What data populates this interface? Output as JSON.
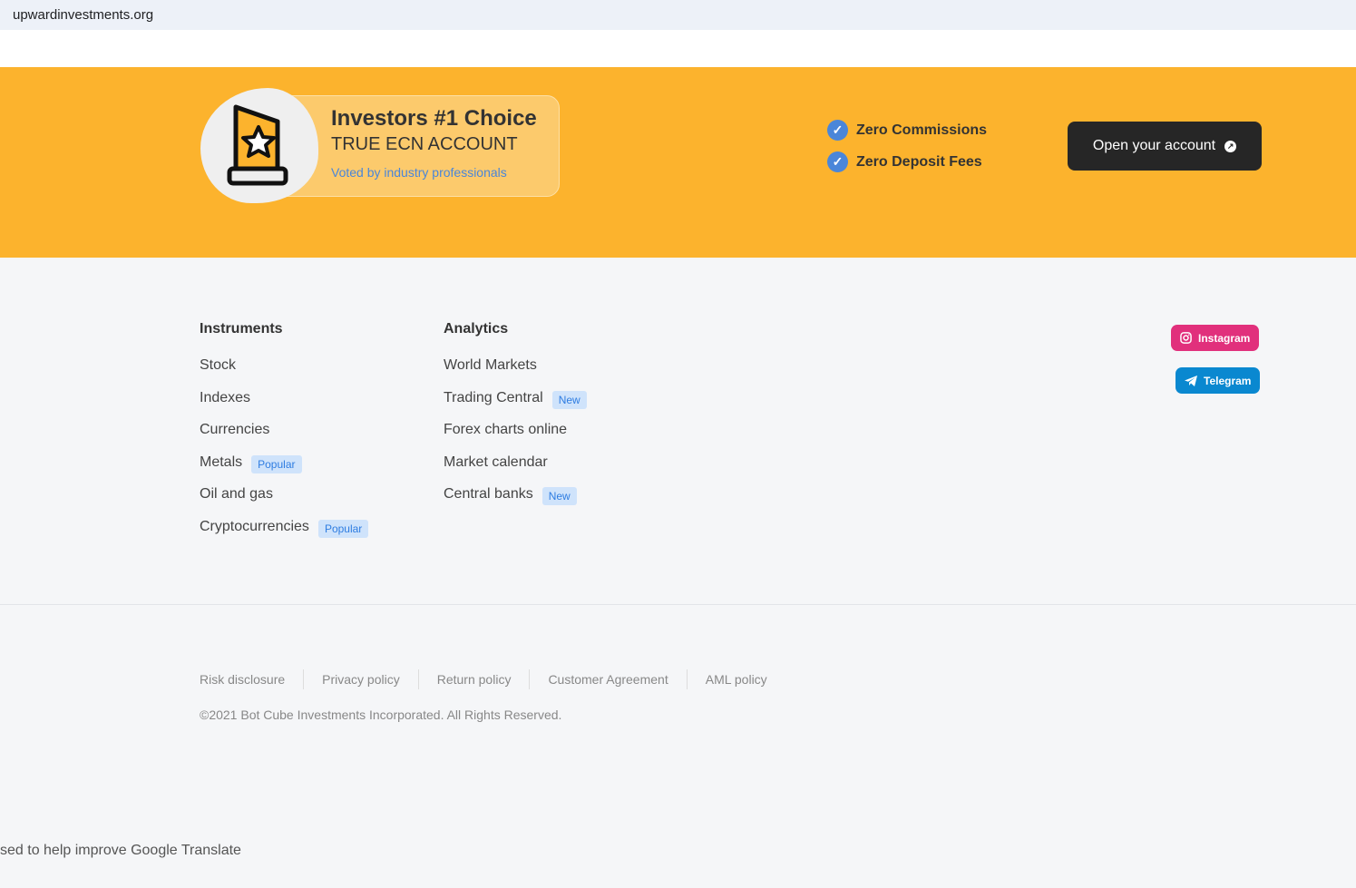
{
  "browser": {
    "url": "upwardinvestments.org"
  },
  "banner": {
    "title": "Investors #1 Choice",
    "subtitle": "TRUE ECN ACCOUNT",
    "tagline": "Voted by industry professionals",
    "features": [
      "Zero Commissions",
      "Zero Deposit Fees"
    ],
    "cta": "Open your account"
  },
  "instruments": {
    "heading": "Instruments",
    "items": [
      {
        "label": "Stock"
      },
      {
        "label": "Indexes"
      },
      {
        "label": "Currencies"
      },
      {
        "label": "Metals",
        "badge": "Popular"
      },
      {
        "label": "Oil and gas"
      },
      {
        "label": "Cryptocurrencies",
        "badge": "Popular"
      }
    ]
  },
  "analytics": {
    "heading": "Analytics",
    "items": [
      {
        "label": "World Markets"
      },
      {
        "label": "Trading Central",
        "badge": "New"
      },
      {
        "label": "Forex charts online"
      },
      {
        "label": "Market calendar"
      },
      {
        "label": "Central banks",
        "badge": "New"
      }
    ]
  },
  "social": {
    "instagram": "Instagram",
    "telegram": "Telegram",
    "instagram_color": "#e1307c",
    "telegram_color": "#0a88d0"
  },
  "footer": {
    "links": [
      "Risk disclosure",
      "Privacy policy",
      "Return policy",
      "Customer Agreement",
      "AML policy"
    ],
    "copyright": "©2021 Bot Cube Investments Incorporated. All Rights Reserved."
  },
  "translate_notice": "sed to help improve Google Translate"
}
